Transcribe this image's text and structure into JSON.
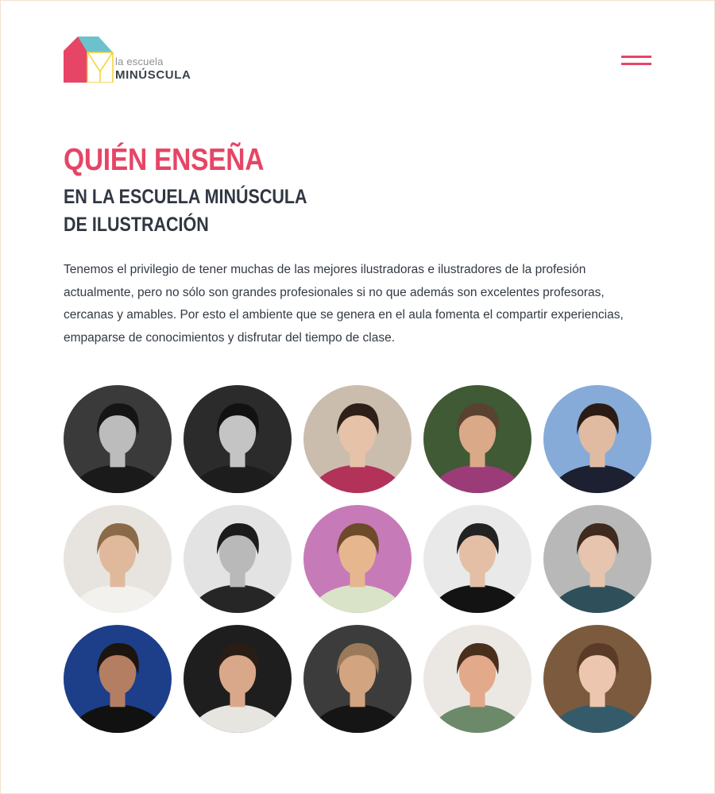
{
  "header": {
    "logo": {
      "line1": "la escuela",
      "line2": "MINÚSCULA",
      "colors": {
        "house": "#e64566",
        "roof": "#6cc2cc",
        "accent": "#f2d230"
      }
    },
    "menu_icon": "hamburger-menu-icon"
  },
  "hero": {
    "title": "QUIÉN ENSEÑA",
    "subtitle_line1": "EN LA ESCUELA MINÚSCULA",
    "subtitle_line2": "DE ILUSTRACIÓN",
    "intro": "Tenemos el privilegio de tener muchas de las mejores ilustradoras e ilustradores de la profesión actualmente, pero no sólo son grandes profesionales si no que además son excelentes profesoras, cercanas y amables. Por esto el ambiente que se genera en el aula fomenta el compartir experiencias, empaparse de conocimientos y disfrutar del tiempo de clase."
  },
  "colors": {
    "accent": "#e64566",
    "text": "#2f3742"
  },
  "teachers": [
    {
      "bg": "#3a3a3a",
      "skin": "#bcbcbc",
      "hair": "#151515",
      "shirt": "#1a1a1a"
    },
    {
      "bg": "#2b2b2b",
      "skin": "#c4c4c4",
      "hair": "#121212",
      "shirt": "#1d1d1d"
    },
    {
      "bg": "#cbbdae",
      "skin": "#e6c2a8",
      "hair": "#2e2018",
      "shirt": "#b2325a"
    },
    {
      "bg": "#3f5a34",
      "skin": "#d9a988",
      "hair": "#5a4230",
      "shirt": "#9b3c78"
    },
    {
      "bg": "#86abd8",
      "skin": "#e1bba1",
      "hair": "#2a1c15",
      "shirt": "#1c2030"
    },
    {
      "bg": "#e7e4e0",
      "skin": "#e0b99c",
      "hair": "#8a6a48",
      "shirt": "#f3f1ed"
    },
    {
      "bg": "#e3e3e3",
      "skin": "#b9b9b9",
      "hair": "#1b1b1b",
      "shirt": "#262626"
    },
    {
      "bg": "#c77ab8",
      "skin": "#e6b68f",
      "hair": "#6d4a2a",
      "shirt": "#d9e3c8"
    },
    {
      "bg": "#e9e9e9",
      "skin": "#e5bfa5",
      "hair": "#222222",
      "shirt": "#131313"
    },
    {
      "bg": "#b8b8b8",
      "skin": "#e6c4ad",
      "hair": "#3e2a1e",
      "shirt": "#2f4f5a"
    },
    {
      "bg": "#1d3f8a",
      "skin": "#b47e63",
      "hair": "#1c140f",
      "shirt": "#111111"
    },
    {
      "bg": "#1e1e1e",
      "skin": "#d9a88a",
      "hair": "#2a1d15",
      "shirt": "#e7e5e0"
    },
    {
      "bg": "#3c3c3c",
      "skin": "#d2a47f",
      "hair": "#9b7a5c",
      "shirt": "#151515"
    },
    {
      "bg": "#ebe8e4",
      "skin": "#e2a98a",
      "hair": "#4a2e1c",
      "shirt": "#6c8a6a"
    },
    {
      "bg": "#7b5a3e",
      "skin": "#ecc6ae",
      "hair": "#5a3b27",
      "shirt": "#355b6a"
    }
  ]
}
